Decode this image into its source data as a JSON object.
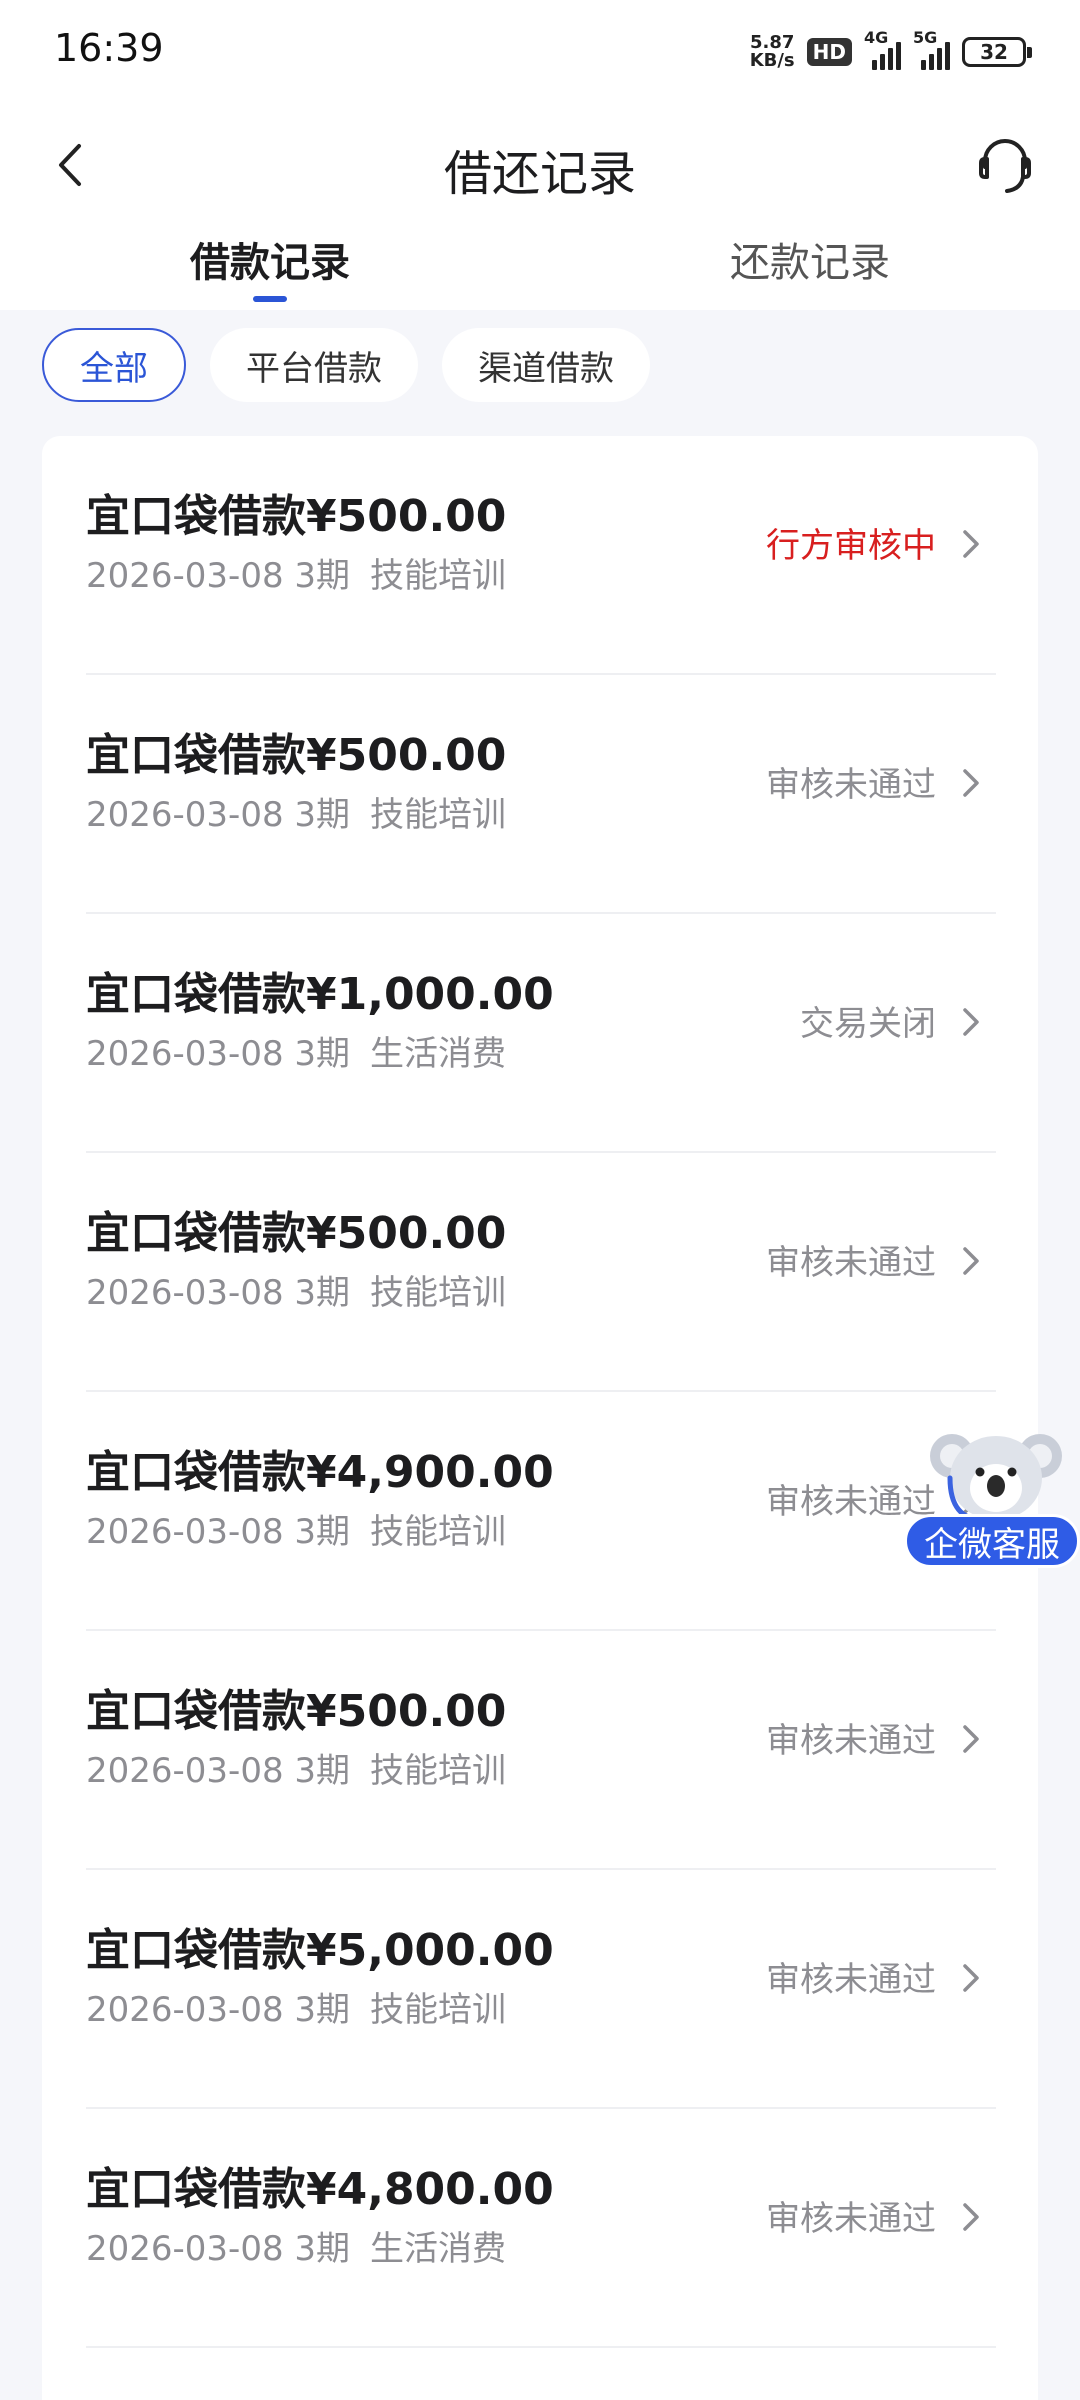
{
  "status_bar": {
    "time": "16:39",
    "net_speed_value": "5.87",
    "net_speed_unit": "KB/s",
    "hd_badge": "HD",
    "network_4g": "4G",
    "network_5g": "5G",
    "battery": "32"
  },
  "header": {
    "title": "借还记录",
    "back_icon": "chevron-left-icon",
    "support_icon": "headset-icon"
  },
  "tabs": [
    {
      "label": "借款记录",
      "active": true
    },
    {
      "label": "还款记录",
      "active": false
    }
  ],
  "filters": [
    {
      "label": "全部",
      "selected": true
    },
    {
      "label": "平台借款",
      "selected": false
    },
    {
      "label": "渠道借款",
      "selected": false
    }
  ],
  "records": [
    {
      "title": "宜口袋借款¥500.00",
      "date_term": "2026-03-08 3期",
      "category": "技能培训",
      "status": "行方审核中"
    },
    {
      "title": "宜口袋借款¥500.00",
      "date_term": "2026-03-08 3期",
      "category": "技能培训",
      "status": "审核未通过"
    },
    {
      "title": "宜口袋借款¥1,000.00",
      "date_term": "2026-03-08 3期",
      "category": "生活消费",
      "status": "交易关闭"
    },
    {
      "title": "宜口袋借款¥500.00",
      "date_term": "2026-03-08 3期",
      "category": "技能培训",
      "status": "审核未通过"
    },
    {
      "title": "宜口袋借款¥4,900.00",
      "date_term": "2026-03-08 3期",
      "category": "技能培训",
      "status": "审核未通过"
    },
    {
      "title": "宜口袋借款¥500.00",
      "date_term": "2026-03-08 3期",
      "category": "技能培训",
      "status": "审核未通过"
    },
    {
      "title": "宜口袋借款¥5,000.00",
      "date_term": "2026-03-08 3期",
      "category": "技能培训",
      "status": "审核未通过"
    },
    {
      "title": "宜口袋借款¥4,800.00",
      "date_term": "2026-03-08 3期",
      "category": "生活消费",
      "status": "审核未通过"
    }
  ],
  "floating_service": {
    "label": "企微客服",
    "icon": "koala-mascot-icon"
  },
  "colors": {
    "accent": "#2b55d6",
    "pending_status": "#d81f1f",
    "muted_text": "#8d8d92",
    "page_bg": "#f5f6fa"
  }
}
